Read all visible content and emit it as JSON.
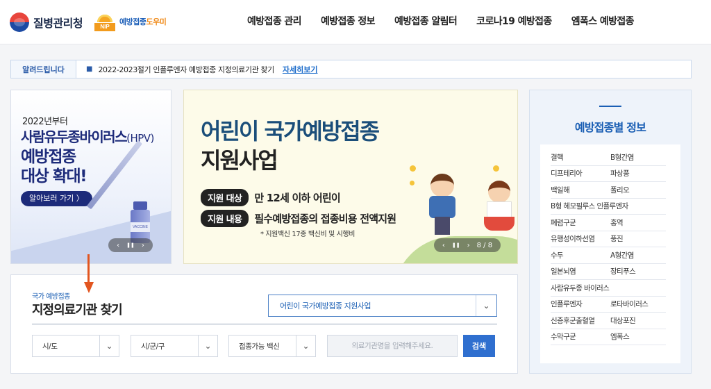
{
  "header": {
    "org_name": "질병관리청",
    "nip_name_blue": "예방접종",
    "nip_name_orange": "도우미",
    "nip_mark_text": "NIP",
    "nav": [
      "예방접종 관리",
      "예방접종 정보",
      "예방접종 알림터",
      "코로나19 예방접종",
      "엠폭스 예방접종"
    ]
  },
  "notice": {
    "label": "알려드립니다",
    "text": "2022-2023절기 인플루엔자 예방접종 지정의료기관 찾기",
    "link": "자세히보기"
  },
  "hpv_banner": {
    "year": "2022년부터",
    "line1": "사람유두종바이러스",
    "line1_sub": "(HPV)",
    "line2": "예방접종",
    "line3": "대상 확대!",
    "button": "알아보러 가기 〉",
    "vial_label": "VACCINE",
    "controls": {
      "prev": "‹",
      "pause": "❚❚",
      "next": "›"
    }
  },
  "main_banner": {
    "title_line1": "어린이 국가예방접종",
    "title_line2": "지원사업",
    "rows": [
      {
        "label": "지원 대상",
        "value": "만 12세 이하 어린이"
      },
      {
        "label": "지원 내용",
        "value": "필수예방접종의 접종비용 전액지원"
      }
    ],
    "note": "* 지원백신 17종 백신비 및 시행비",
    "controls": {
      "prev": "‹",
      "pause": "❚❚",
      "next": "›",
      "counter": "8 / 8"
    }
  },
  "info_panel": {
    "title": "예방접종별 정보",
    "rows": [
      [
        "결핵",
        "B형간염"
      ],
      [
        "디프테리아",
        "파상풍"
      ],
      [
        "백일해",
        "폴리오"
      ],
      [
        "B형 헤모필루스 인플루엔자"
      ],
      [
        "폐렴구균",
        "홍역"
      ],
      [
        "유행성이하선염",
        "풍진"
      ],
      [
        "수두",
        "A형간염"
      ],
      [
        "일본뇌염",
        "장티푸스"
      ],
      [
        "사람유두종 바이러스"
      ],
      [
        "인플루엔자",
        "로타바이러스"
      ],
      [
        "신증후군출혈열",
        "대상포진"
      ],
      [
        "수막구균",
        "엠폭스"
      ]
    ]
  },
  "finder": {
    "subtitle": "국가 예방접종",
    "title": "지정의료기관 찾기",
    "program_select": "어린이 국가예방접종 지원사업",
    "selects": [
      "시/도",
      "시/군/구",
      "접종가능 백신"
    ],
    "search_placeholder": "의료기관명을 입력해주세요.",
    "search_button": "검색"
  },
  "colors": {
    "primary": "#1b5fb4",
    "accent_arrow": "#e2551f",
    "button": "#2f6fcf"
  }
}
